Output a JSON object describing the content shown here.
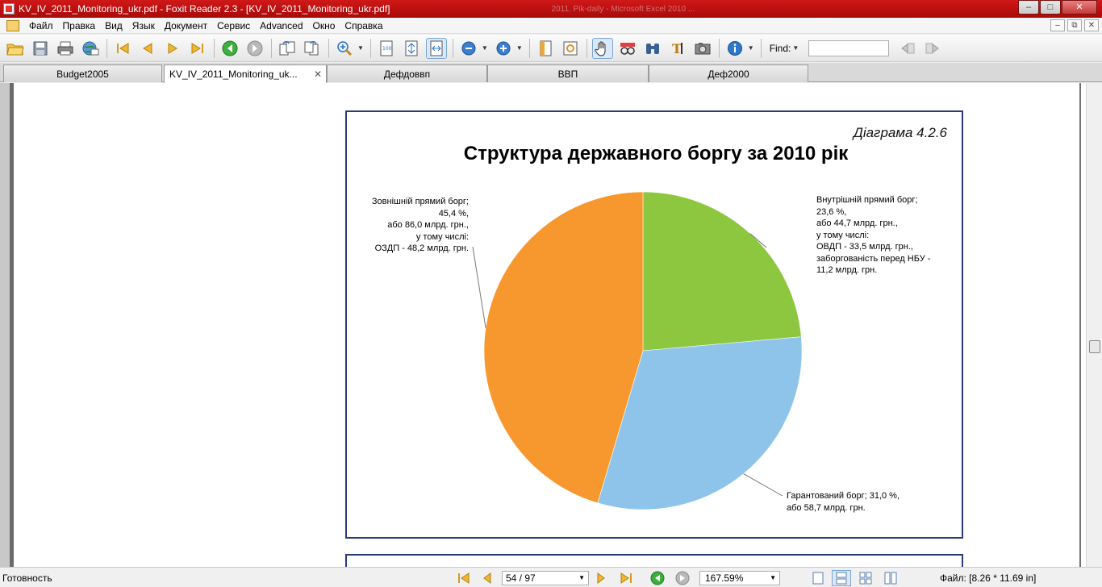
{
  "window": {
    "title": "KV_IV_2011_Monitoring_ukr.pdf - Foxit Reader 2.3 - [KV_IV_2011_Monitoring_ukr.pdf]",
    "background_title": "2011. Pik-daily - Microsoft Excel 2010 ..."
  },
  "menu": {
    "items": [
      "Файл",
      "Правка",
      "Вид",
      "Язык",
      "Документ",
      "Сервис",
      "Advanced",
      "Окно",
      "Справка"
    ]
  },
  "toolbar": {
    "find_label": "Find:",
    "find_value": ""
  },
  "tabs": [
    {
      "label": "Budget2005"
    },
    {
      "label": "KV_IV_2011_Monitoring_uk...",
      "close": "✕"
    },
    {
      "label": "Дефдоввп"
    },
    {
      "label": "ВВП"
    },
    {
      "label": "Деф2000"
    }
  ],
  "document": {
    "diagram_number": "Діаграма 4.2.6",
    "title": "Структура державного боргу за 2010 рік",
    "labels": {
      "external": [
        "Зовнішній прямий борг;",
        "45,4 %,",
        "або 86,0 млрд. грн.,",
        "у тому числі:",
        "ОЗДП - 48,2 млрд. грн."
      ],
      "domestic": [
        "Внутрішній прямий борг;",
        "23,6 %,",
        "або 44,7 млрд. грн.,",
        "у тому числі:",
        "ОВДП - 33,5 млрд. грн.,",
        "заборгованість перед НБУ -",
        "11,2 млрд. грн."
      ],
      "guaranteed": [
        "Гарантований борг; 31,0 %,",
        "або 58,7 млрд. грн."
      ]
    }
  },
  "chart_data": {
    "type": "pie",
    "title": "Структура державного боргу за 2010 рік",
    "slices": [
      {
        "name": "Внутрішній прямий борг",
        "percent": 23.6,
        "value_bn_uah": 44.7,
        "color": "#8dc63f"
      },
      {
        "name": "Гарантований борг",
        "percent": 31.0,
        "value_bn_uah": 58.7,
        "color": "#8ec4ea"
      },
      {
        "name": "Зовнішній прямий борг",
        "percent": 45.4,
        "value_bn_uah": 86.0,
        "color": "#f7982f"
      }
    ]
  },
  "status": {
    "ready": "Готовность",
    "page": "54 / 97",
    "zoom": "167.59%",
    "file_size": "Файл: [8.26 * 11.69 in]"
  }
}
